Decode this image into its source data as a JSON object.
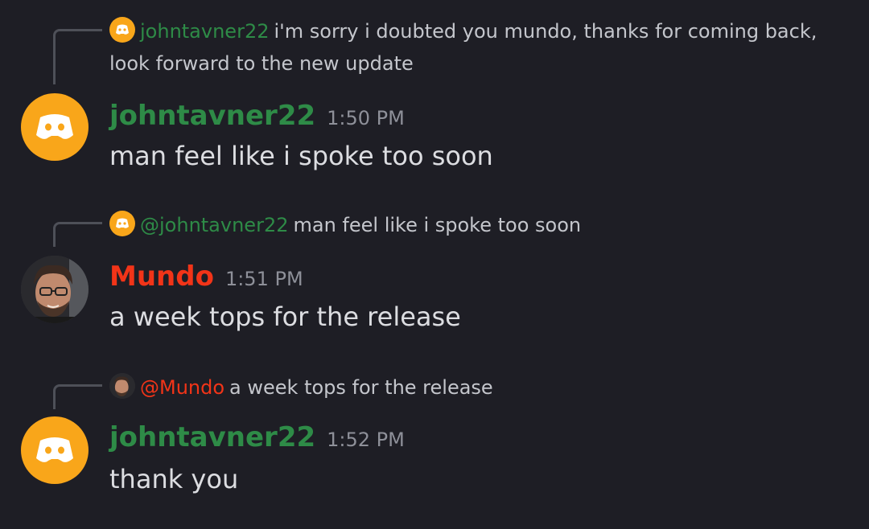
{
  "messages": [
    {
      "reply": {
        "name": "johntavner22",
        "text": "i'm sorry i doubted you mundo, thanks for coming back, look forward to the new update"
      },
      "author": "johntavner22",
      "time": "1:50 PM",
      "content": "man feel like i spoke too soon"
    },
    {
      "reply": {
        "name": "@johntavner22",
        "text": "man feel like i spoke too soon"
      },
      "author": "Mundo",
      "time": "1:51 PM",
      "content": "a week tops for the release"
    },
    {
      "reply": {
        "name": "@Mundo",
        "text": "a week tops for the release"
      },
      "author": "johntavner22",
      "time": "1:52 PM",
      "content": "thank you"
    }
  ],
  "colors": {
    "background": "#1e1e25",
    "johntavner_color": "#2e8b47",
    "mundo_color": "#f23418",
    "discord_avatar": "#f9a61a"
  },
  "icons": {
    "discord_avatar": "discord-logo-icon",
    "user_photo": "user-photo-avatar"
  }
}
